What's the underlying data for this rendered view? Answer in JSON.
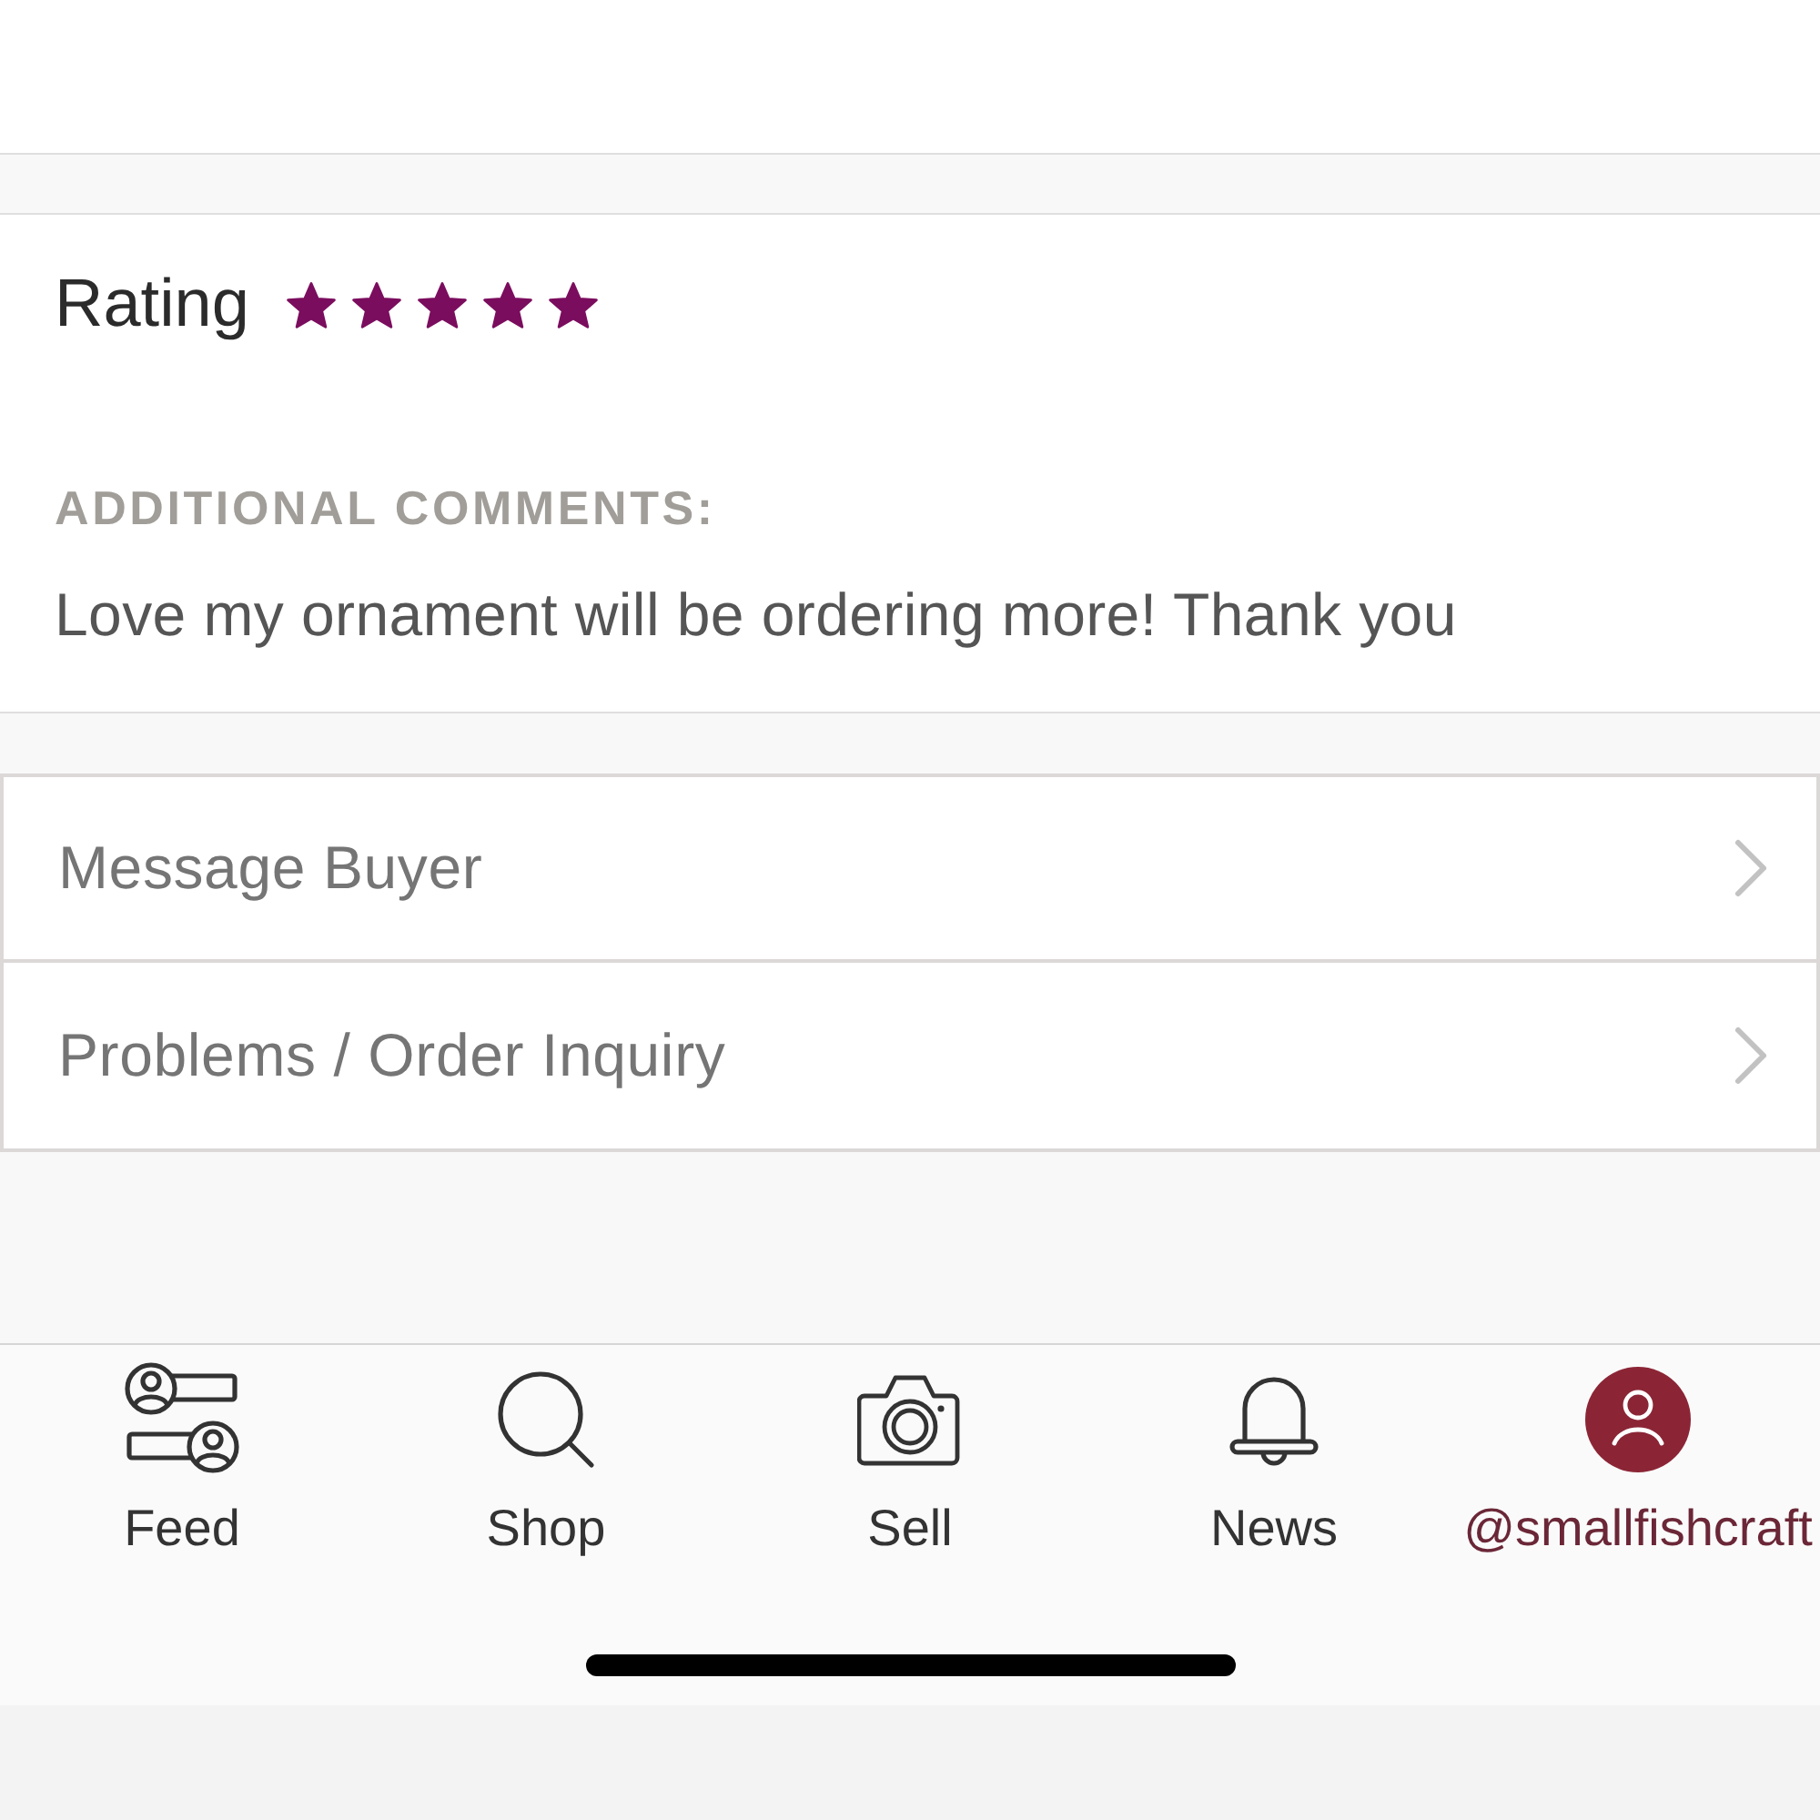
{
  "review": {
    "rating_label": "Rating",
    "stars": 5,
    "comments_label": "ADDITIONAL COMMENTS:",
    "comment": "Love my ornament will be ordering more! Thank you"
  },
  "actions": [
    {
      "label": "Message Buyer"
    },
    {
      "label": "Problems / Order Inquiry"
    }
  ],
  "tabs": [
    {
      "label": "Feed",
      "selected": false
    },
    {
      "label": "Shop",
      "selected": false
    },
    {
      "label": "Sell",
      "selected": false
    },
    {
      "label": "News",
      "selected": false
    },
    {
      "label": "@smallfishcraft",
      "selected": true
    }
  ]
}
